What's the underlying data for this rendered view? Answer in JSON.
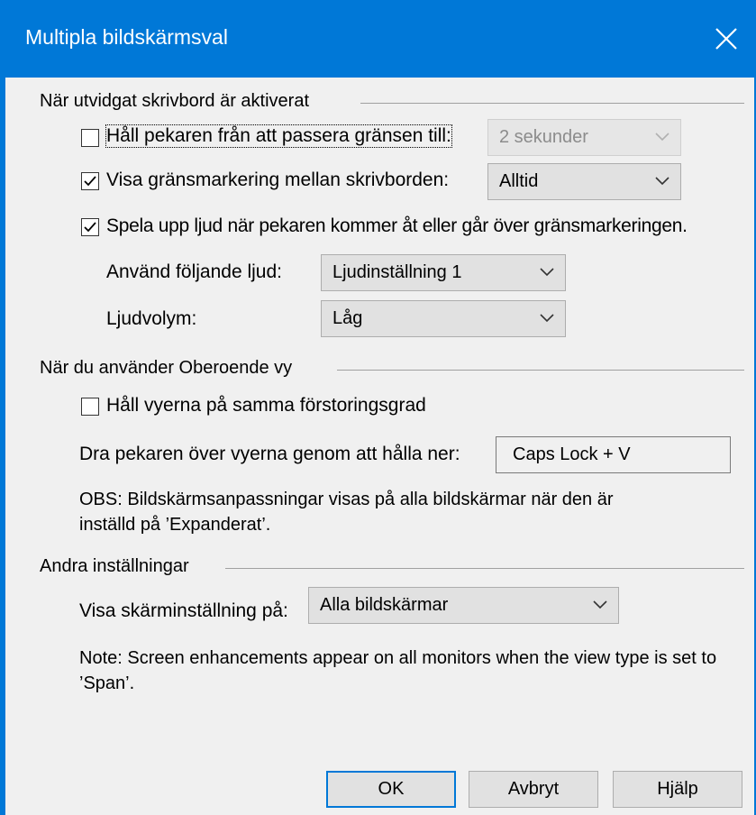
{
  "window": {
    "title": "Multipla bildskärmsval",
    "accent": "#0078d7"
  },
  "extended_desktop": {
    "group_label": "När utvidgat skrivbord är aktiverat",
    "hold_pointer_label": "Håll pekaren från att passera gränsen till:",
    "hold_pointer_checked": false,
    "hold_pointer_value": "2 sekunder",
    "show_boundary_label": "Visa gränsmarkering mellan skrivborden:",
    "show_boundary_checked": true,
    "show_boundary_value": "Alltid",
    "play_sound_label": "Spela upp ljud när pekaren kommer åt eller går över gränsmarkeringen.",
    "play_sound_checked": true,
    "sound_label": "Använd följande ljud:",
    "sound_value": "Ljudinställning 1",
    "volume_label": "Ljudvolym:",
    "volume_value": "Låg"
  },
  "independent_view": {
    "group_label": "När du använder Oberoende vy",
    "same_zoom_label": "Håll vyerna på samma förstoringsgrad",
    "same_zoom_checked": false,
    "drag_label": "Dra pekaren över vyerna genom att hålla ner:",
    "drag_hotkey": "Caps Lock + V",
    "note": "OBS: Bildskärmsanpassningar visas på alla bildskärmar när den är inställd på ’Expanderat’."
  },
  "other_settings": {
    "group_label": "Andra inställningar",
    "display_on_label": "Visa skärminställning på:",
    "display_on_value": "Alla bildskärmar",
    "note": "Note: Screen enhancements appear on all monitors when the view type is set to ’Span’."
  },
  "buttons": {
    "ok": "OK",
    "cancel": "Avbryt",
    "help": "Hjälp"
  }
}
